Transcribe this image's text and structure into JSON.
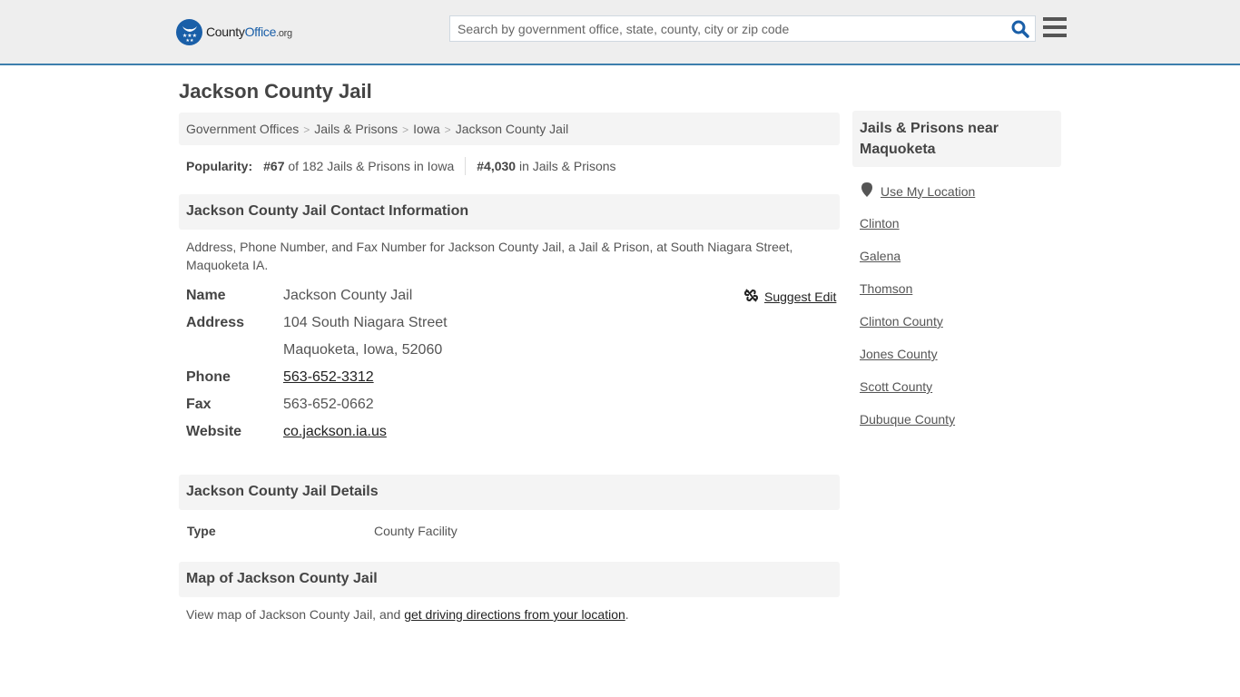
{
  "header": {
    "logo": {
      "county": "County",
      "office": "Office",
      "org": ".org"
    },
    "search_placeholder": "Search by government office, state, county, city or zip code",
    "search_icon": "search-icon",
    "menu_icon": "hamburger-menu-icon"
  },
  "page_title": "Jackson County Jail",
  "breadcrumb": [
    {
      "label": "Government Offices"
    },
    {
      "label": "Jails & Prisons"
    },
    {
      "label": "Iowa"
    },
    {
      "label": "Jackson County Jail"
    }
  ],
  "breadcrumb_separator": ">",
  "popularity": {
    "label": "Popularity:",
    "state_rank": "#67",
    "state_rank_text": " of 182 Jails & Prisons in Iowa",
    "national_rank": "#4,030",
    "national_rank_text": " in Jails & Prisons"
  },
  "contact": {
    "heading": "Jackson County Jail Contact Information",
    "description": "Address, Phone Number, and Fax Number for Jackson County Jail, a Jail & Prison, at South Niagara Street, Maquoketa IA.",
    "suggest_edit": "Suggest Edit",
    "rows": {
      "name": {
        "label": "Name",
        "value": "Jackson County Jail"
      },
      "address": {
        "label": "Address",
        "line1": "104 South Niagara Street",
        "line2": "Maquoketa, Iowa, 52060"
      },
      "phone": {
        "label": "Phone",
        "value": "563-652-3312"
      },
      "fax": {
        "label": "Fax",
        "value": "563-652-0662"
      },
      "website": {
        "label": "Website",
        "value": "co.jackson.ia.us"
      }
    }
  },
  "details": {
    "heading": "Jackson County Jail Details",
    "type_label": "Type",
    "type_value": "County Facility"
  },
  "map": {
    "heading": "Map of Jackson County Jail",
    "text": "View map of Jackson County Jail, and ",
    "link": "get driving directions from your location",
    "suffix": "."
  },
  "sidebar": {
    "heading": "Jails & Prisons near Maquoketa",
    "use_location": "Use My Location",
    "links": [
      "Clinton",
      "Galena",
      "Thomson",
      "Clinton County",
      "Jones County",
      "Scott County",
      "Dubuque County"
    ]
  },
  "colors": {
    "brand": "#1a5fa8",
    "header_bg": "#eeeeee",
    "header_border": "#3d7fad",
    "panel_bg": "#f4f4f4"
  }
}
